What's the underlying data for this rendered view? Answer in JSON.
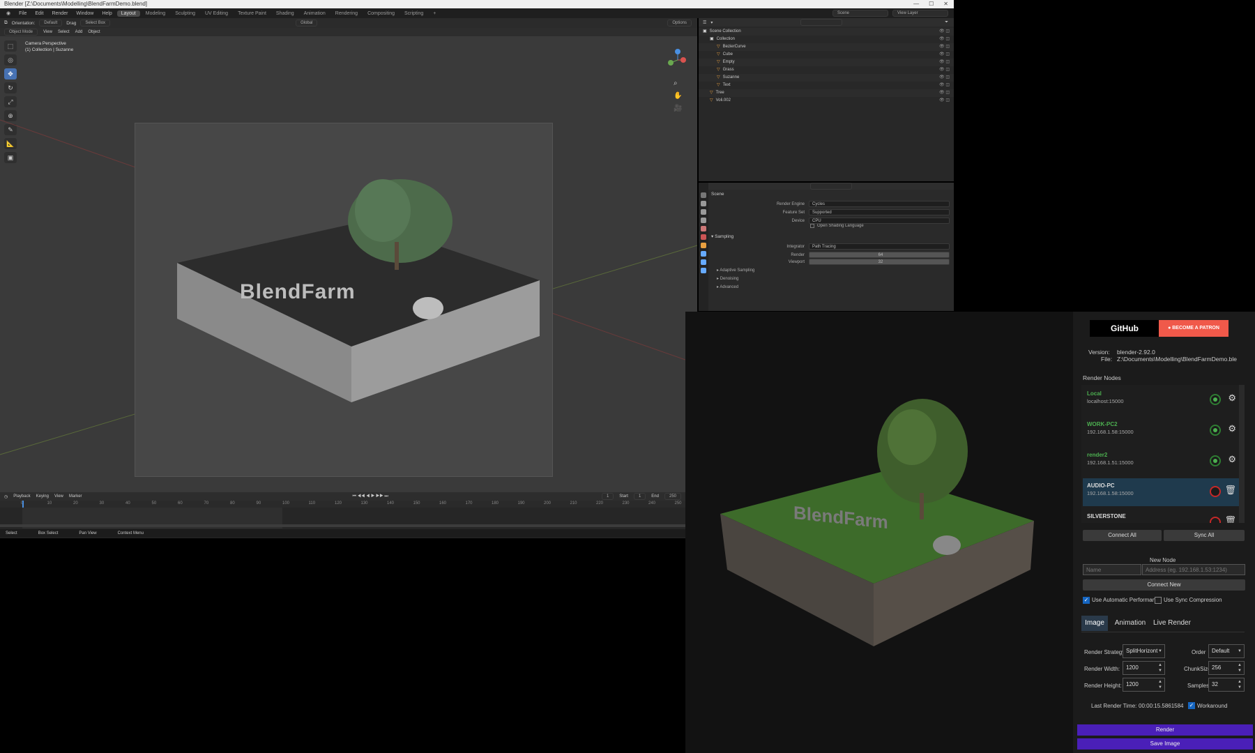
{
  "titlebar": {
    "title": "Blender [Z:\\Documents\\Modelling\\BlendFarmDemo.blend]"
  },
  "menu": [
    "File",
    "Edit",
    "Render",
    "Window",
    "Help"
  ],
  "workspaces": [
    "Layout",
    "Modeling",
    "Sculpting",
    "UV Editing",
    "Texture Paint",
    "Shading",
    "Animation",
    "Rendering",
    "Compositing",
    "Scripting",
    "+"
  ],
  "active_workspace": "Layout",
  "topbar_right": {
    "scene": "Scene",
    "view_layer": "View Layer"
  },
  "viewport": {
    "header": {
      "orientation": "Orientation:",
      "orientation_val": "Default",
      "drag": "Drag",
      "drag_val": "Select Box",
      "global": "Global",
      "options": "Options"
    },
    "header2": [
      "Object Mode",
      "View",
      "Select",
      "Add",
      "Object"
    ],
    "info_line1": "Camera Perspective",
    "info_line2": "(1) Collection | Suzanne",
    "scene_text": "BlendFarm"
  },
  "timeline": {
    "menus": [
      "Playback",
      "Keying",
      "View",
      "Marker"
    ],
    "frame": "1",
    "start_label": "Start",
    "start": "1",
    "end_label": "End",
    "end": "250",
    "ruler": [
      "0",
      "10",
      "20",
      "30",
      "40",
      "50",
      "60",
      "70",
      "80",
      "90",
      "100",
      "110",
      "120",
      "130",
      "140",
      "150",
      "160",
      "170",
      "180",
      "190",
      "200",
      "210",
      "220",
      "230",
      "240",
      "250"
    ]
  },
  "statusbar": [
    "Select",
    "Box Select",
    "Pan View",
    "Context Menu"
  ],
  "outliner": {
    "rows": [
      {
        "label": "Scene Collection",
        "indent": 0
      },
      {
        "label": "Collection",
        "indent": 1
      },
      {
        "label": "BezierCurve",
        "indent": 2
      },
      {
        "label": "Cube",
        "indent": 2
      },
      {
        "label": "Empty",
        "indent": 2
      },
      {
        "label": "Grass",
        "indent": 2
      },
      {
        "label": "Suzanne",
        "indent": 2
      },
      {
        "label": "Text",
        "indent": 2
      },
      {
        "label": "Tree",
        "indent": 1
      },
      {
        "label": "Voli.002",
        "indent": 1
      }
    ]
  },
  "properties": {
    "scene": "Scene",
    "rows": [
      {
        "label": "Render Engine",
        "value": "Cycles"
      },
      {
        "label": "Feature Set",
        "value": "Supported"
      },
      {
        "label": "Device",
        "value": "CPU"
      }
    ],
    "osl": "Open Shading Language",
    "sampling": "Sampling",
    "integrator_label": "Integrator",
    "integrator": "Path Tracing",
    "render_label": "Render",
    "render_val": "64",
    "viewport_label": "Viewport",
    "viewport_val": "32",
    "subsections": [
      "Adaptive Sampling",
      "Denoising",
      "Advanced"
    ]
  },
  "blendfarm": {
    "github": "GitHub",
    "patron": "BECOME A PATRON",
    "version_label": "Version:",
    "version": "blender-2.92.0",
    "file_label": "File:",
    "file": "Z:\\Documents\\Modelling\\BlendFarmDemo.ble",
    "render_nodes": "Render Nodes",
    "nodes": [
      {
        "name": "Local",
        "address": "localhost:15000",
        "status": "connected"
      },
      {
        "name": "WORK-PC2",
        "address": "192.168.1.58:15000",
        "status": "connected"
      },
      {
        "name": "render2",
        "address": "192.168.1.51:15000",
        "status": "connected"
      },
      {
        "name": "AUDIO-PC",
        "address": "192.168.1.58:15000",
        "status": "disconnected"
      },
      {
        "name": "SILVERSTONE",
        "address": "",
        "status": "disconnected"
      }
    ],
    "connect_all": "Connect All",
    "sync_all": "Sync All",
    "new_node": "New Node",
    "name_placeholder": "Name",
    "address_placeholder": "Address (eg. 192.168.1.53:1234)",
    "connect_new": "Connect New",
    "use_auto_perf": "Use Automatic Performance",
    "use_sync_comp": "Use Sync Compression",
    "tabs": [
      "Image",
      "Animation",
      "Live Render"
    ],
    "active_tab": "Image",
    "render_strategy_label": "Render Strategy",
    "render_strategy": "SplitHorizont",
    "order_label": "Order",
    "order": "Default",
    "render_width_label": "Render Width:",
    "render_width": "1200",
    "chunksize_label": "ChunkSize",
    "chunksize": "256",
    "render_height_label": "Render Height:",
    "render_height": "1200",
    "samples_label": "Samples",
    "samples": "32",
    "last_render_label": "Last Render Time:",
    "last_render": "00:00:15.5861584",
    "workaround": "Workaround",
    "render_btn": "Render",
    "save_btn": "Save Image",
    "preview_text": "BlendFarm",
    "accent_purple": "#4a1fb8",
    "patron_color": "#f0594a",
    "node_green": "#4caf50"
  }
}
